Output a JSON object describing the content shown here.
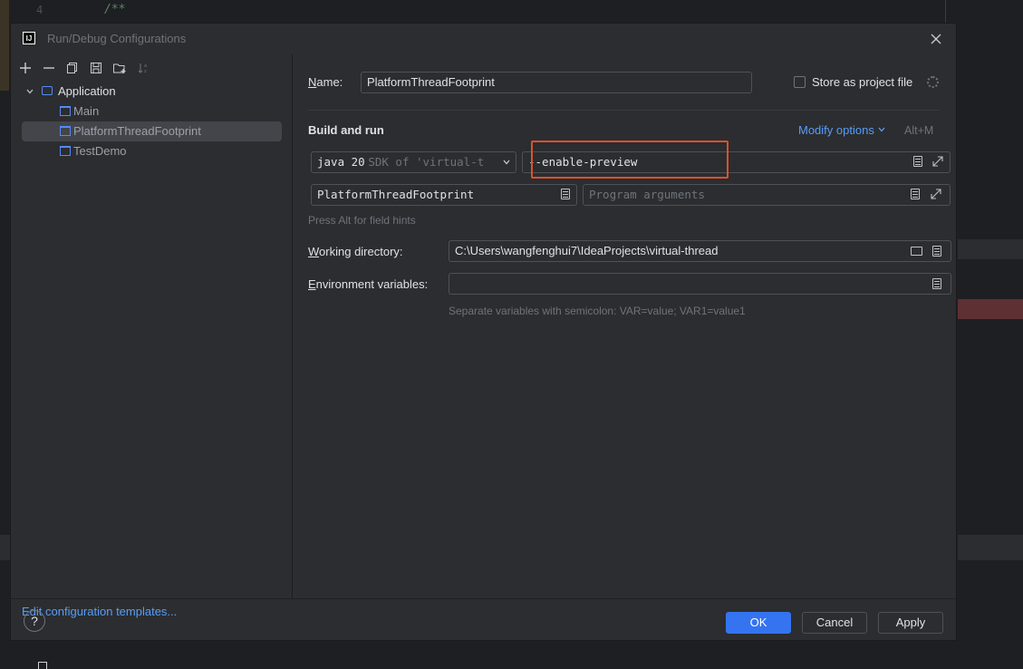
{
  "editor": {
    "line_number": "4",
    "code_text": "/**"
  },
  "dialog": {
    "title": "Run/Debug Configurations",
    "app_icon_text": "IJ"
  },
  "toolbar": {
    "add": "+",
    "remove": "−"
  },
  "tree": {
    "root_label": "Application",
    "items": [
      {
        "label": "Main"
      },
      {
        "label": "PlatformThreadFootprint",
        "selected": true
      },
      {
        "label": "TestDemo"
      }
    ]
  },
  "edit_templates_label": "Edit configuration templates...",
  "form": {
    "name_label_first": "N",
    "name_label_rest": "ame:",
    "name_value": "PlatformThreadFootprint",
    "store_label": "Store as project file",
    "section_title": "Build and run",
    "modify_options_label": "Modify options",
    "modify_shortcut": "Alt+M",
    "sdk_main": "java 20",
    "sdk_sub": "SDK of 'virtual-t",
    "vm_options_value": "--enable-preview",
    "main_class_value": "PlatformThreadFootprint",
    "program_args_placeholder": "Program arguments",
    "field_hint": "Press Alt for field hints",
    "working_dir_label_first": "W",
    "working_dir_label_rest": "orking directory:",
    "working_dir_value": "C:\\Users\\wangfenghui7\\IdeaProjects\\virtual-thread",
    "env_label_first": "E",
    "env_label_rest": "nvironment variables:",
    "env_value": "",
    "env_hint": "Separate variables with semicolon: VAR=value; VAR1=value1"
  },
  "footer": {
    "help": "?",
    "ok": "OK",
    "cancel": "Cancel",
    "apply": "Apply"
  },
  "colors": {
    "accent": "#3574f0",
    "link": "#589df6",
    "highlight": "#e0502a"
  }
}
